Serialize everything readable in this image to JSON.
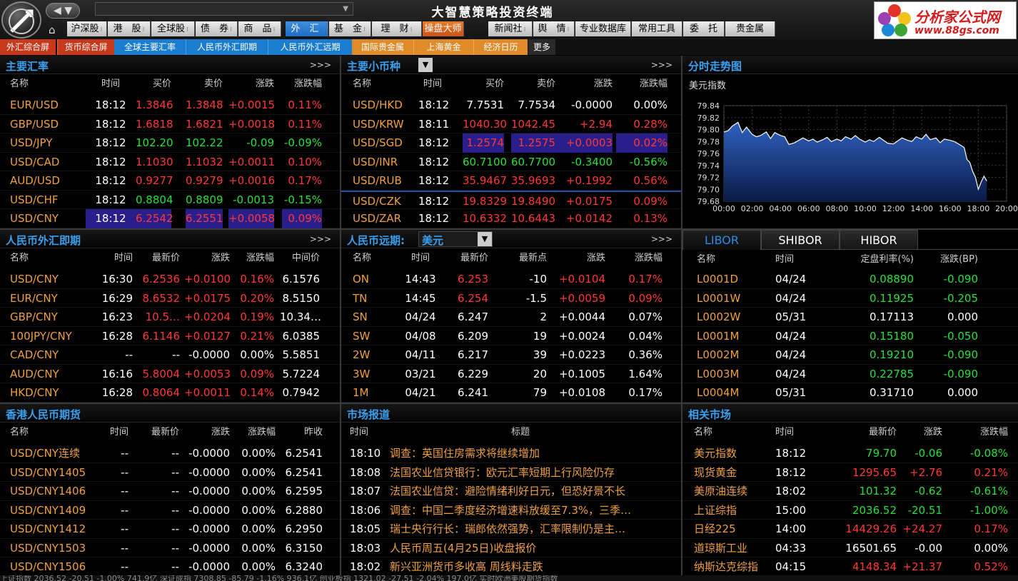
{
  "app_title": "大智慧策略投资终端",
  "colors": {
    "accent": "#3aa0f0",
    "up": "#ff3838",
    "down": "#28e03a",
    "label": "#f0a040"
  },
  "nav": {
    "arrows": "◀ ▼",
    "address": "",
    "address_drop": "▼",
    "home_icon": "home-icon"
  },
  "main_tabs": [
    {
      "label": "沪深股",
      "dots": "⁝"
    },
    {
      "label": "港　股",
      "dots": "⁝"
    },
    {
      "label": "全球股",
      "dots": "⁝"
    },
    {
      "label": "债　券",
      "dots": "⁝"
    },
    {
      "label": "商　品",
      "dots": "⁝"
    },
    {
      "label": "外　汇",
      "dots": "⁝"
    },
    {
      "label": "基　金",
      "dots": "⁝"
    },
    {
      "label": "理　财",
      "dots": "⁝"
    },
    {
      "label": "操盘大师",
      "dots": ""
    },
    {
      "label": "新闻社",
      "dots": "⁝"
    },
    {
      "label": "舆　情",
      "dots": "⁝"
    },
    {
      "label": "专业数据库",
      "dots": ""
    },
    {
      "label": "常用工具",
      "dots": ""
    },
    {
      "label": "委　托",
      "dots": ""
    },
    {
      "label": "贵金属",
      "dots": ""
    }
  ],
  "brand": {
    "line1": "分析家公式网",
    "line2": "www.88gs.com"
  },
  "sub_tabs": [
    "外汇综合屏",
    "货币综合屏",
    "全球主要汇率",
    "人民币外汇即期",
    "人民币外汇远期",
    "国际贵金属",
    "上海黄金",
    "经济日历",
    "更多"
  ],
  "major": {
    "title": "主要汇率",
    "more": ">>>",
    "headers": [
      "名称",
      "时间",
      "买价",
      "卖价",
      "涨跌",
      "涨跌幅"
    ],
    "rows": [
      [
        "EUR/USD",
        "18:12",
        "1.3846",
        "1.3848",
        "+0.0015",
        "0.11%"
      ],
      [
        "GBP/USD",
        "18:12",
        "1.6818",
        "1.6821",
        "+0.0018",
        "0.11%"
      ],
      [
        "USD/JPY",
        "18:12",
        "102.20",
        "102.22",
        "-0.09",
        "-0.09%"
      ],
      [
        "USD/CAD",
        "18:12",
        "1.1030",
        "1.1032",
        "+0.0011",
        "0.10%"
      ],
      [
        "AUD/USD",
        "18:12",
        "0.9277",
        "0.9279",
        "+0.0016",
        "0.17%"
      ],
      [
        "USD/CHF",
        "18:12",
        "0.8804",
        "0.8809",
        "-0.0013",
        "-0.15%"
      ],
      [
        "USD/CNY",
        "18:12",
        "6.2542",
        "6.2551",
        "+0.0058",
        "0.09%"
      ]
    ]
  },
  "minor": {
    "title": "主要小币种",
    "drop": "▼",
    "more": ">>>",
    "headers": [
      "名称",
      "时间",
      "买价",
      "卖价",
      "涨跌",
      "涨跌幅"
    ],
    "rows": [
      [
        "USD/HKD",
        "18:12",
        "7.7531",
        "7.7534",
        "-0.0000",
        "0.00%"
      ],
      [
        "USD/KRW",
        "18:11",
        "1040.30",
        "1042.45",
        "+2.94",
        "0.28%"
      ],
      [
        "USD/SGD",
        "18:12",
        "1.2574",
        "1.2575",
        "+0.0003",
        "0.02%"
      ],
      [
        "USD/INR",
        "18:12",
        "60.7100",
        "60.7700",
        "-0.3400",
        "-0.56%"
      ],
      [
        "USD/RUB",
        "18:12",
        "35.9467",
        "35.9693",
        "+0.1992",
        "0.56%"
      ],
      [
        "USD/CZK",
        "18:12",
        "19.8329",
        "19.8490",
        "+0.0175",
        "0.09%"
      ],
      [
        "USD/ZAR",
        "18:12",
        "10.6332",
        "10.6443",
        "+0.0142",
        "0.13%"
      ]
    ]
  },
  "intraday": {
    "title": "分时走势图",
    "subtitle": "美元指数"
  },
  "chart_data": {
    "type": "area",
    "title": "美元指数",
    "xlabel": "",
    "ylabel": "",
    "x_ticks": [
      "00:00",
      "02:00",
      "04:00",
      "06:00",
      "08:00",
      "10:00",
      "12:00",
      "14:00",
      "16:00",
      "18:00",
      "20:00"
    ],
    "y_ticks": [
      "79.84",
      "79.82",
      "79.80",
      "79.78",
      "79.76",
      "79.74",
      "79.72",
      "79.70",
      "79.68"
    ],
    "ylim": [
      79.68,
      79.84
    ],
    "xlim": [
      0,
      20
    ],
    "series": [
      {
        "x": [
          0,
          0.3,
          0.6,
          1,
          1.3,
          1.6,
          2,
          2.3,
          2.6,
          3,
          3.3,
          3.6,
          4,
          4.3,
          4.6,
          5,
          5.3,
          5.6,
          6,
          6.3,
          6.6,
          7,
          7.3,
          7.6,
          8,
          8.3,
          8.6,
          9,
          9.3,
          9.6,
          10,
          10.3,
          10.6,
          11,
          11.3,
          11.6,
          12,
          12.3,
          12.6,
          13,
          13.3,
          13.6,
          14,
          14.3,
          14.6,
          15,
          15.3,
          15.6,
          16,
          16.3,
          16.6,
          17,
          17.2,
          17.4,
          17.6,
          17.8,
          18,
          18.2,
          18.4,
          18.6
        ],
        "y": [
          79.796,
          79.798,
          79.806,
          79.812,
          79.795,
          79.804,
          79.792,
          79.788,
          79.79,
          79.796,
          79.785,
          79.795,
          79.79,
          79.788,
          79.775,
          79.778,
          79.782,
          79.786,
          79.781,
          79.784,
          79.779,
          79.783,
          79.787,
          79.78,
          79.784,
          79.781,
          79.788,
          79.784,
          79.79,
          79.784,
          79.779,
          79.783,
          79.78,
          79.787,
          79.782,
          79.777,
          79.776,
          79.781,
          79.786,
          79.782,
          79.78,
          79.788,
          79.784,
          79.792,
          79.783,
          79.786,
          79.778,
          79.784,
          79.782,
          79.78,
          79.776,
          79.77,
          79.75,
          79.745,
          79.73,
          79.72,
          79.7,
          79.712,
          79.722,
          79.714
        ]
      }
    ]
  },
  "spot": {
    "title": "人民币外汇即期",
    "more": ">>>",
    "headers": [
      "名称",
      "时间",
      "最新价",
      "涨跌",
      "涨跌幅",
      "中间价"
    ],
    "rows": [
      [
        "USD/CNY",
        "16:30",
        "6.2536",
        "+0.0100",
        "0.16%",
        "6.1576"
      ],
      [
        "EUR/CNY",
        "16:29",
        "8.6532",
        "+0.0175",
        "0.20%",
        "8.5150"
      ],
      [
        "GBP/CNY",
        "16:23",
        "10.5…",
        "+0.0204",
        "0.19%",
        "10.34…"
      ],
      [
        "100JPY/CNY",
        "16:28",
        "6.1146",
        "+0.0127",
        "0.21%",
        "6.0385"
      ],
      [
        "CAD/CNY",
        "--",
        "--",
        "-0.0000",
        "0.00%",
        "5.5851"
      ],
      [
        "AUD/CNY",
        "16:16",
        "5.8004",
        "+0.0053",
        "0.09%",
        "5.7224"
      ],
      [
        "HKD/CNY",
        "16:28",
        "0.8064",
        "+0.0011",
        "0.14%",
        "0.7942"
      ]
    ]
  },
  "forward": {
    "title": "人民币远期:",
    "currency": "美元",
    "drop": "▼",
    "more": ">>>",
    "headers": [
      "名称",
      "时间",
      "最新价",
      "最新点",
      "涨跌",
      "涨跌幅"
    ],
    "rows": [
      [
        "ON",
        "14:43",
        "6.253",
        "-10",
        "+0.0104",
        "0.17%"
      ],
      [
        "TN",
        "14:45",
        "6.254",
        "-1.5",
        "+0.0059",
        "0.09%"
      ],
      [
        "SN",
        "04/24",
        "6.247",
        "2",
        "+0.0044",
        "0.07%"
      ],
      [
        "SW",
        "04/08",
        "6.209",
        "19",
        "+0.0024",
        "0.04%"
      ],
      [
        "2W",
        "04/11",
        "6.217",
        "39",
        "+0.0223",
        "0.36%"
      ],
      [
        "3W",
        "03/21",
        "6.229",
        "20",
        "+0.1005",
        "1.64%"
      ],
      [
        "1M",
        "04/21",
        "6.241",
        "79",
        "+0.0108",
        "0.17%"
      ]
    ]
  },
  "rates": {
    "tabs": [
      "LIBOR",
      "SHIBOR",
      "HIBOR"
    ],
    "headers": [
      "名称",
      "时间",
      "定盘利率(%)",
      "涨跌(BP)"
    ],
    "rows": [
      [
        "L0001D",
        "04/24",
        "0.08890",
        "-0.090"
      ],
      [
        "L0001W",
        "04/24",
        "0.11925",
        "-0.205"
      ],
      [
        "L0002W",
        "05/31",
        "0.17113",
        "0.000"
      ],
      [
        "L0001M",
        "04/24",
        "0.15180",
        "-0.050"
      ],
      [
        "L0002M",
        "04/24",
        "0.19210",
        "-0.090"
      ],
      [
        "L0003M",
        "04/24",
        "0.22785",
        "-0.090"
      ],
      [
        "L0004M",
        "05/31",
        "0.31710",
        "0.000"
      ]
    ]
  },
  "futures": {
    "title": "香港人民币期货",
    "headers": [
      "名称",
      "时间",
      "最新价",
      "涨跌",
      "涨跌幅",
      "昨收"
    ],
    "rows": [
      [
        "USD/CNY连续",
        "--",
        "--",
        "-0.0000",
        "0.00%",
        "6.2541"
      ],
      [
        "USD/CNY1405",
        "--",
        "--",
        "-0.0000",
        "0.00%",
        "6.2541"
      ],
      [
        "USD/CNY1406",
        "--",
        "--",
        "-0.0000",
        "0.00%",
        "6.2595"
      ],
      [
        "USD/CNY1409",
        "--",
        "--",
        "-0.0000",
        "0.00%",
        "6.2880"
      ],
      [
        "USD/CNY1412",
        "--",
        "--",
        "-0.0000",
        "0.00%",
        "6.2950"
      ],
      [
        "USD/CNY1503",
        "--",
        "--",
        "-0.0000",
        "0.00%",
        "6.3150"
      ],
      [
        "USD/CNY1506",
        "--",
        "--",
        "-0.0000",
        "0.00%",
        "6.3240"
      ]
    ]
  },
  "news": {
    "title": "市场报道",
    "headers": [
      "时间",
      "标题"
    ],
    "rows": [
      [
        "18:10",
        "调查：英国住房需求将继续增加"
      ],
      [
        "18:08",
        "法国农业信贷银行：欧元汇率短期上行风险仍存"
      ],
      [
        "18:07",
        "法国农业信贷：避险情绪利好日元，但恐好景不长"
      ],
      [
        "18:06",
        "调查：中国二季度经济增速料放缓至7.3%，三季…"
      ],
      [
        "18:05",
        "瑞士央行行长：瑞郎依然强势，汇率限制仍是主…"
      ],
      [
        "18:03",
        "人民币周五(4月25日)收盘报价"
      ],
      [
        "18:02",
        "新兴亚洲货币多收高 周线料走跌"
      ]
    ]
  },
  "related": {
    "title": "相关市场",
    "headers": [
      "名称",
      "时间",
      "最新价",
      "涨跌",
      "涨跌幅"
    ],
    "rows": [
      [
        "美元指数",
        "18:12",
        "79.70",
        "-0.06",
        "-0.08%"
      ],
      [
        "现货黄金",
        "18:12",
        "1295.65",
        "+2.76",
        "0.21%"
      ],
      [
        "美原油连续",
        "18:02",
        "101.32",
        "-0.62",
        "-0.61%"
      ],
      [
        "上证综指",
        "15:00",
        "2036.52",
        "-20.51",
        "-1.00%"
      ],
      [
        "日经225",
        "14:00",
        "14429.26",
        "+24.27",
        "0.17%"
      ],
      [
        "道琼斯工业",
        "04:33",
        "16501.65",
        "-0.00",
        "0.00%"
      ],
      [
        "纳斯达克综指",
        "04:15",
        "4148.34",
        "+21.37",
        "0.52%"
      ]
    ]
  },
  "status": "上证指数 2036.52 -20.51 -1.00% 741.9亿 深证成指 7308.85 -85.79 -1.16% 936.1亿 创业板指 1321.02 -27.51 -2.04% 197.0亿 实时欧洲美股期货指数"
}
